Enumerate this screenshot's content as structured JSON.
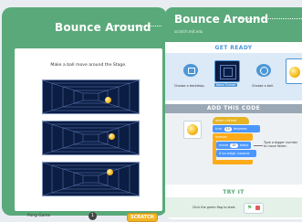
{
  "left_card": {
    "title": "Bounce Around",
    "instruction": "Make a ball move around the Stage.",
    "footer_label": "Pong Game",
    "footer_number": "1",
    "footer_logo": "SCRATCH"
  },
  "right_card": {
    "title": "Bounce Around",
    "subtitle": "scratch.mit.edu",
    "get_ready": {
      "title": "GET READY",
      "step1_label": "Choose a backdrop.",
      "step2_label": "Neon Tunnel",
      "step3_label": "Choose a ball."
    },
    "add_code": {
      "title": "ADD THIS CODE",
      "hat_block": "when clicked",
      "turn_block": "turn",
      "turn_value": "15",
      "turn_unit": "degrees",
      "forever_block": "forever",
      "move_block": "move",
      "move_value": "15",
      "move_unit": "steps",
      "bounce_block": "if on edge, bounce",
      "tip": "Type a bigger number to move faster."
    },
    "try_it": {
      "title": "TRY IT",
      "instruction": "Click the green flag to start."
    }
  },
  "colors": {
    "green": "#5aa97a",
    "blue_section": "#4c97d6",
    "event_yellow": "#e6b424",
    "motion_blue": "#4c97ff",
    "control_orange": "#ffab19"
  }
}
